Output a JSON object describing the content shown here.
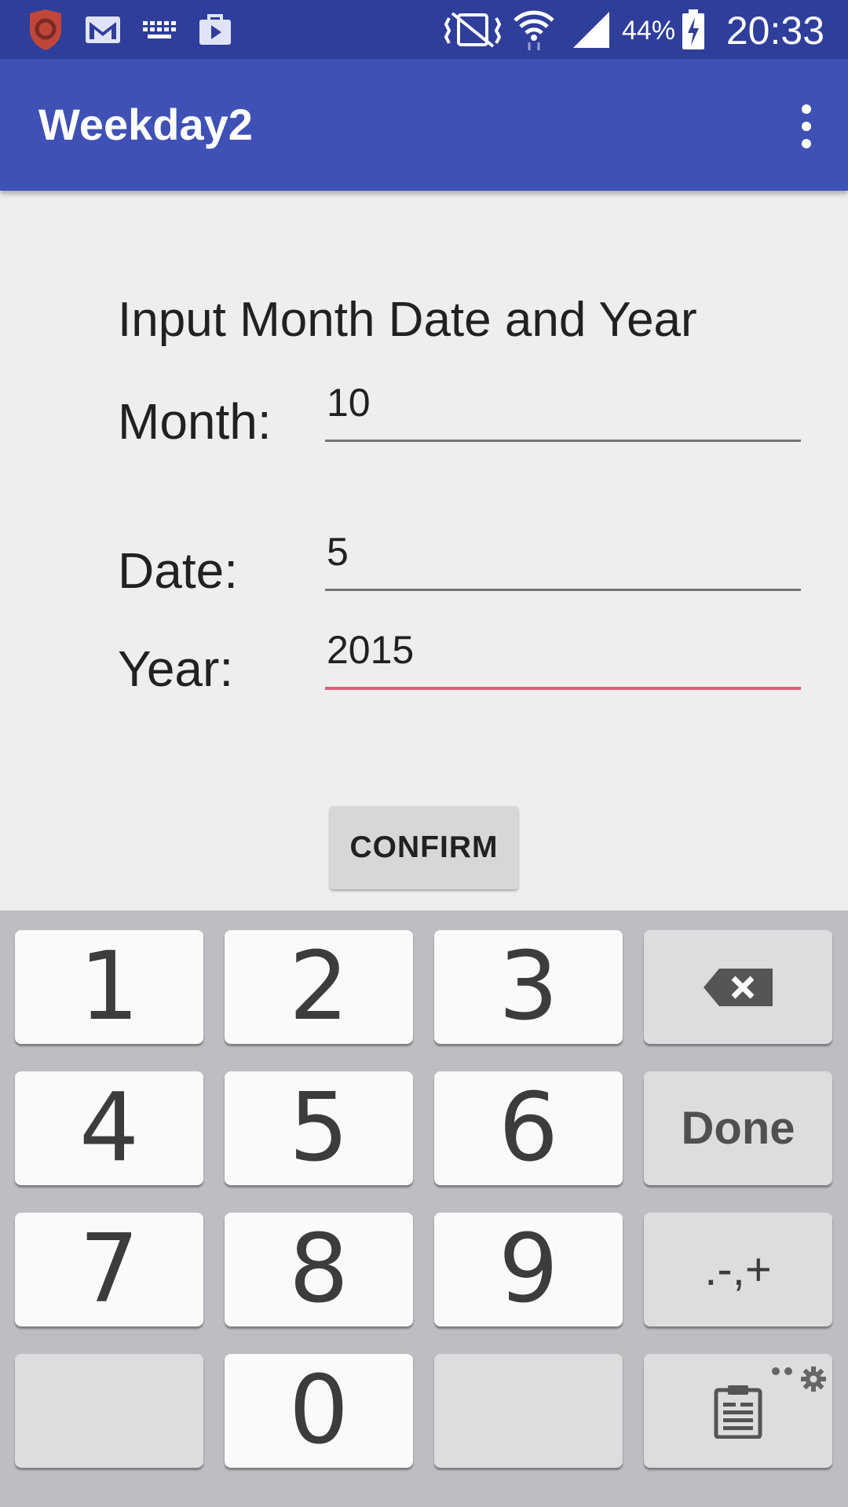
{
  "status_bar": {
    "battery_percent": "44%",
    "time": "20:33",
    "icons": [
      "shield-app-icon",
      "gmail-icon",
      "keyboard-icon",
      "briefcase-icon",
      "vibrate-icon",
      "wifi-icon",
      "signal-icon",
      "battery-charging-icon"
    ]
  },
  "app_bar": {
    "title": "Weekday2",
    "menu_icon": "overflow-menu-icon"
  },
  "form": {
    "heading": "Input Month Date and Year",
    "month_label": "Month:",
    "month_value": "10",
    "date_label": "Date:",
    "date_value": "5",
    "year_label": "Year:",
    "year_value": "2015",
    "confirm_label": "CONFIRM"
  },
  "keyboard": {
    "keys": [
      "1",
      "2",
      "3",
      "4",
      "5",
      "6",
      "7",
      "8",
      "9",
      "0"
    ],
    "done_label": "Done",
    "symbols_label": ".-,+",
    "backspace_icon": "backspace-icon",
    "clipboard_icon": "clipboard-icon",
    "settings_icon": "settings-gear-icon"
  },
  "colors": {
    "status_bar": "#2e3e9a",
    "app_bar": "#3f51b5",
    "accent": "#e0607e",
    "background": "#eeeeee"
  }
}
